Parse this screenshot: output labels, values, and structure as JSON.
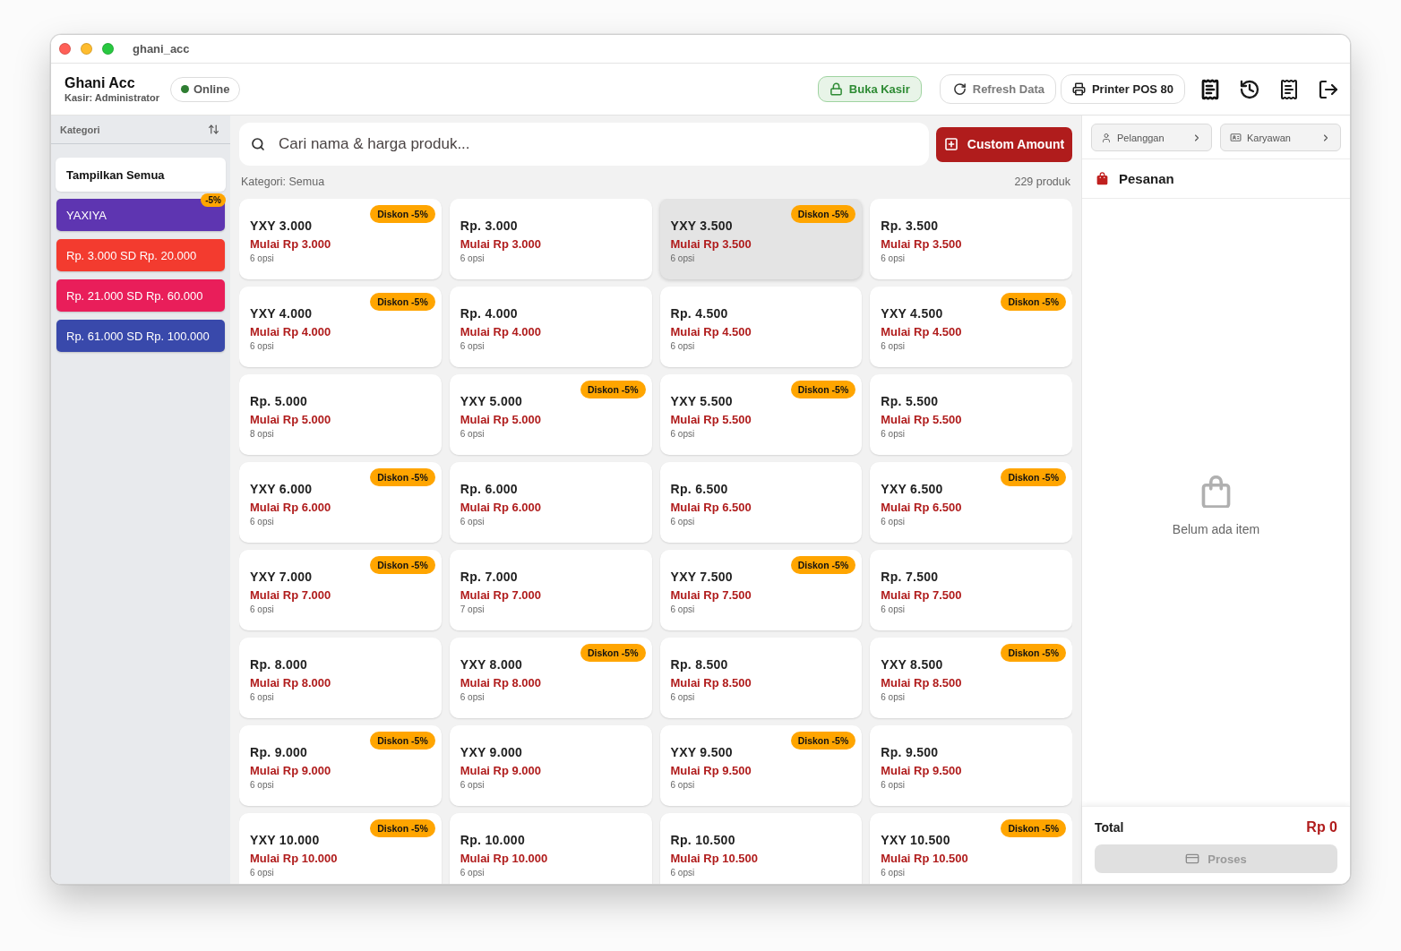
{
  "window": {
    "title": "ghani_acc"
  },
  "header": {
    "store_name": "Ghani Acc",
    "cashier": "Kasir: Administrator",
    "status": {
      "label": "Online",
      "online": true
    },
    "buttons": [
      {
        "label": "Buka Kasir",
        "kind": "open_register"
      },
      {
        "label": "Refresh Data",
        "kind": "refresh"
      },
      {
        "label": "Printer POS 80",
        "kind": "printer"
      }
    ]
  },
  "sidebar": {
    "title": "Kategori",
    "items": [
      {
        "label": "Tampilkan Semua",
        "selected": true
      },
      {
        "label": "YAXIYA",
        "selected": false,
        "color": "#5e35b1",
        "badge": "-5%"
      },
      {
        "label": "Rp. 3.000 SD Rp. 20.000",
        "selected": false,
        "color": "#f33b2f"
      },
      {
        "label": "Rp. 21.000 SD Rp. 60.000",
        "selected": false,
        "color": "#e91e5a"
      },
      {
        "label": "Rp. 61.000 SD Rp. 100.000",
        "selected": false,
        "color": "#3949ab"
      }
    ]
  },
  "search": {
    "placeholder": "Cari nama & harga produk..."
  },
  "custom_amount_button": "Custom Amount",
  "filter_label": "Kategori: Semua",
  "product_count": "229 produk",
  "products": [
    {
      "name": "YXY 3.000",
      "price": "Mulai Rp 3.000",
      "options": "6 opsi",
      "badge": "Diskon -5%",
      "highlighted": false
    },
    {
      "name": "Rp. 3.000",
      "price": "Mulai Rp 3.000",
      "options": "6 opsi",
      "highlighted": false
    },
    {
      "name": "YXY 3.500",
      "price": "Mulai Rp 3.500",
      "options": "6 opsi",
      "badge": "Diskon -5%",
      "highlighted": true
    },
    {
      "name": "Rp. 3.500",
      "price": "Mulai Rp 3.500",
      "options": "6 opsi",
      "highlighted": false
    },
    {
      "name": "YXY 4.000",
      "price": "Mulai Rp 4.000",
      "options": "6 opsi",
      "badge": "Diskon -5%",
      "highlighted": false
    },
    {
      "name": "Rp. 4.000",
      "price": "Mulai Rp 4.000",
      "options": "6 opsi",
      "highlighted": false
    },
    {
      "name": "Rp. 4.500",
      "price": "Mulai Rp 4.500",
      "options": "6 opsi",
      "highlighted": false
    },
    {
      "name": "YXY 4.500",
      "price": "Mulai Rp 4.500",
      "options": "6 opsi",
      "badge": "Diskon -5%",
      "highlighted": false
    },
    {
      "name": "Rp. 5.000",
      "price": "Mulai Rp 5.000",
      "options": "8 opsi",
      "highlighted": false
    },
    {
      "name": "YXY 5.000",
      "price": "Mulai Rp 5.000",
      "options": "6 opsi",
      "badge": "Diskon -5%",
      "highlighted": false
    },
    {
      "name": "YXY 5.500",
      "price": "Mulai Rp 5.500",
      "options": "6 opsi",
      "badge": "Diskon -5%",
      "highlighted": false
    },
    {
      "name": "Rp. 5.500",
      "price": "Mulai Rp 5.500",
      "options": "6 opsi",
      "highlighted": false
    },
    {
      "name": "YXY 6.000",
      "price": "Mulai Rp 6.000",
      "options": "6 opsi",
      "badge": "Diskon -5%",
      "highlighted": false
    },
    {
      "name": "Rp. 6.000",
      "price": "Mulai Rp 6.000",
      "options": "6 opsi",
      "highlighted": false
    },
    {
      "name": "Rp. 6.500",
      "price": "Mulai Rp 6.500",
      "options": "6 opsi",
      "highlighted": false
    },
    {
      "name": "YXY 6.500",
      "price": "Mulai Rp 6.500",
      "options": "6 opsi",
      "badge": "Diskon -5%",
      "highlighted": false
    },
    {
      "name": "YXY 7.000",
      "price": "Mulai Rp 7.000",
      "options": "6 opsi",
      "badge": "Diskon -5%",
      "highlighted": false
    },
    {
      "name": "Rp. 7.000",
      "price": "Mulai Rp 7.000",
      "options": "7 opsi",
      "highlighted": false
    },
    {
      "name": "YXY 7.500",
      "price": "Mulai Rp 7.500",
      "options": "6 opsi",
      "badge": "Diskon -5%",
      "highlighted": false
    },
    {
      "name": "Rp. 7.500",
      "price": "Mulai Rp 7.500",
      "options": "6 opsi",
      "highlighted": false
    },
    {
      "name": "Rp. 8.000",
      "price": "Mulai Rp 8.000",
      "options": "6 opsi",
      "highlighted": false
    },
    {
      "name": "YXY 8.000",
      "price": "Mulai Rp 8.000",
      "options": "6 opsi",
      "badge": "Diskon -5%",
      "highlighted": false
    },
    {
      "name": "Rp. 8.500",
      "price": "Mulai Rp 8.500",
      "options": "6 opsi",
      "highlighted": false
    },
    {
      "name": "YXY 8.500",
      "price": "Mulai Rp 8.500",
      "options": "6 opsi",
      "badge": "Diskon -5%",
      "highlighted": false
    },
    {
      "name": "Rp. 9.000",
      "price": "Mulai Rp 9.000",
      "options": "6 opsi",
      "badge": "Diskon -5%",
      "highlighted": false
    },
    {
      "name": "YXY 9.000",
      "price": "Mulai Rp 9.000",
      "options": "6 opsi",
      "highlighted": false
    },
    {
      "name": "YXY 9.500",
      "price": "Mulai Rp 9.500",
      "options": "6 opsi",
      "badge": "Diskon -5%",
      "highlighted": false
    },
    {
      "name": "Rp. 9.500",
      "price": "Mulai Rp 9.500",
      "options": "6 opsi",
      "highlighted": false
    },
    {
      "name": "YXY 10.000",
      "price": "Mulai Rp 10.000",
      "options": "6 opsi",
      "badge": "Diskon -5%",
      "highlighted": false
    },
    {
      "name": "Rp. 10.000",
      "price": "Mulai Rp 10.000",
      "options": "6 opsi",
      "highlighted": false
    },
    {
      "name": "Rp. 10.500",
      "price": "Mulai Rp 10.500",
      "options": "6 opsi",
      "highlighted": false
    },
    {
      "name": "YXY 10.500",
      "price": "Mulai Rp 10.500",
      "options": "6 opsi",
      "badge": "Diskon -5%",
      "highlighted": false
    }
  ],
  "order_panel": {
    "customer_button": "Pelanggan",
    "employee_button": "Karyawan",
    "title": "Pesanan",
    "empty_text": "Belum ada item",
    "total_label": "Total",
    "total_value": "Rp 0",
    "process_button": {
      "label": "Proses",
      "disabled": true
    }
  }
}
